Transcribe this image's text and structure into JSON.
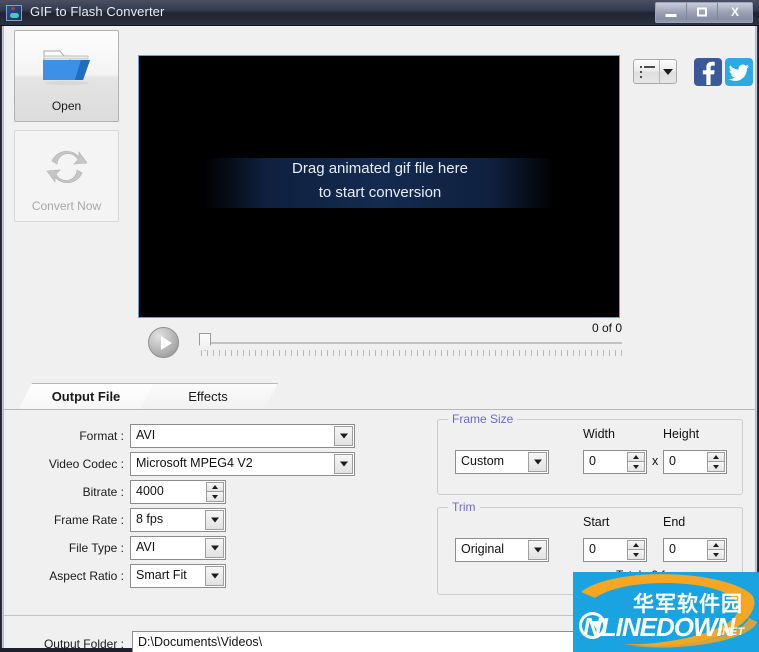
{
  "window": {
    "title": "GIF to Flash Converter",
    "icon": "app-icon",
    "buttons": {
      "minimize": "minimize",
      "maximize": "maximize",
      "close": "X"
    }
  },
  "sidebar": {
    "open_label": "Open",
    "convert_label": "Convert Now"
  },
  "toolbar": {
    "list_icon": "list-icon",
    "dropdown_icon": "chevron-down-icon",
    "facebook_label": "f",
    "twitter_icon": "twitter-bird-icon"
  },
  "preview": {
    "drop_line1": "Drag animated gif file here",
    "drop_line2": "to start conversion",
    "frame_count": "0 of 0",
    "play_icon": "play-icon"
  },
  "tabs": [
    {
      "label": "Output File",
      "active": true
    },
    {
      "label": "Effects",
      "active": false
    }
  ],
  "output_file": {
    "fields": [
      {
        "label": "Format :",
        "value": "AVI",
        "control": "dropdown"
      },
      {
        "label": "Video Codec :",
        "value": "Microsoft MPEG4 V2",
        "control": "dropdown"
      },
      {
        "label": "Bitrate :",
        "value": "4000",
        "control": "spinner"
      },
      {
        "label": "Frame Rate :",
        "value": "8 fps",
        "control": "dropdown"
      },
      {
        "label": "File Type :",
        "value": "AVI",
        "control": "dropdown"
      },
      {
        "label": "Aspect Ratio :",
        "value": "Smart Fit",
        "control": "dropdown"
      }
    ]
  },
  "frame_size": {
    "legend": "Frame Size",
    "preset": "Custom",
    "width_label": "Width",
    "width_value": "0",
    "separator": "x",
    "height_label": "Height",
    "height_value": "0"
  },
  "trim": {
    "legend": "Trim",
    "preset": "Original",
    "start_label": "Start",
    "start_value": "0",
    "end_label": "End",
    "end_value": "0",
    "total_label": "Total : 0 frame"
  },
  "output_folder": {
    "label": "Output Folder :",
    "value": "D:\\Documents\\Videos\\"
  },
  "watermark": {
    "chinese": "华军软件园",
    "brand": "NLINEDOWN",
    "tld": ".NET"
  },
  "colors": {
    "titlebar": "#2b3040",
    "accent_blue": "#6f9ad4",
    "legend": "#6a6ad6",
    "facebook": "#3b5998",
    "twitter": "#2daae1",
    "watermark_bg": "#19a3e0"
  }
}
